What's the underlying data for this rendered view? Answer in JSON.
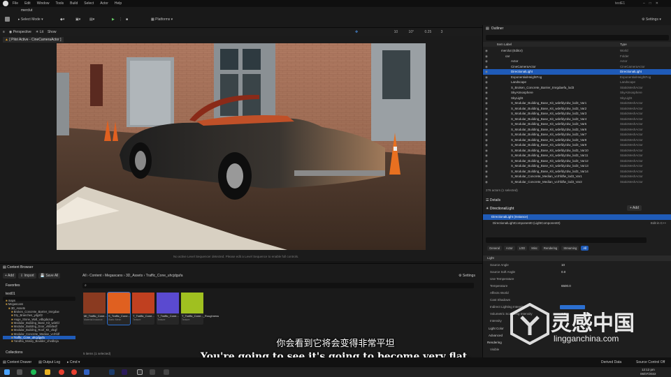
{
  "menubar": {
    "items": [
      "File",
      "Edit",
      "Window",
      "Tools",
      "Build",
      "Select",
      "Actor",
      "Help"
    ],
    "project": "testE1",
    "level": "merclut"
  },
  "toolbar": {
    "select_mode": "Select Mode",
    "platforms": "Platforms",
    "settings": "Settings"
  },
  "viewport": {
    "perspective": "Perspective",
    "lit": "Lit",
    "show": "Show",
    "pilot": "[ Pilot Active - CineCameraActor ]",
    "stats": [
      "10",
      "10°",
      "0.25",
      "3"
    ],
    "notice": "No active Level Sequencer detected. Please edit a Level Sequence to enable full controls."
  },
  "outliner": {
    "tab": "Outliner",
    "col_label": "Item Label",
    "col_type": "Type",
    "footer": "276 actors (1 selected)",
    "rows": [
      {
        "label": "merclut (Editor)",
        "type": "World"
      },
      {
        "label": "car",
        "type": "Folder"
      },
      {
        "label": "Actor",
        "type": "Actor"
      },
      {
        "label": "CineCameraActor",
        "type": "CineCameraActor"
      },
      {
        "label": "DirectionalLight",
        "type": "DirectionalLight",
        "selected": true
      },
      {
        "label": "ExponentialHeightFog",
        "type": "ExponentialHeightFog"
      },
      {
        "label": "Landscape",
        "type": "Landscape"
      },
      {
        "label": "S_Broken_Concrete_Barrier_tmrgdaefa_lod3",
        "type": "StaticMeshActor"
      },
      {
        "label": "SkyAtmosphere",
        "type": "SkyAtmosphere"
      },
      {
        "label": "SkyLight",
        "type": "SkyLight"
      },
      {
        "label": "S_Modular_Building_Base_Kit_wdefdyzdw_lod3_Var1",
        "type": "StaticMeshActor"
      },
      {
        "label": "S_Modular_Building_Base_Kit_wdefdyzdw_lod3_Var2",
        "type": "StaticMeshActor"
      },
      {
        "label": "S_Modular_Building_Base_Kit_wdefdyzdw_lod3_Var3",
        "type": "StaticMeshActor"
      },
      {
        "label": "S_Modular_Building_Base_Kit_wdefdyzdw_lod3_Var4",
        "type": "StaticMeshActor"
      },
      {
        "label": "S_Modular_Building_Base_Kit_wdefdyzdw_lod3_Var5",
        "type": "StaticMeshActor"
      },
      {
        "label": "S_Modular_Building_Base_Kit_wdefdyzdw_lod3_Var6",
        "type": "StaticMeshActor"
      },
      {
        "label": "S_Modular_Building_Base_Kit_wdefdyzdw_lod3_Var7",
        "type": "StaticMeshActor"
      },
      {
        "label": "S_Modular_Building_Base_Kit_wdefdyzdw_lod3_Var8",
        "type": "StaticMeshActor"
      },
      {
        "label": "S_Modular_Building_Base_Kit_wdefdyzdw_lod3_Var9",
        "type": "StaticMeshActor"
      },
      {
        "label": "S_Modular_Building_Base_Kit_wdefdyzdw_lod3_Var10",
        "type": "StaticMeshActor"
      },
      {
        "label": "S_Modular_Building_Base_Kit_wdefdyzdw_lod3_Var11",
        "type": "StaticMeshActor"
      },
      {
        "label": "S_Modular_Building_Base_Kit_wdefdyzdw_lod3_Var12",
        "type": "StaticMeshActor"
      },
      {
        "label": "S_Modular_Building_Base_Kit_wdefdyzdw_lod3_Var13",
        "type": "StaticMeshActor"
      },
      {
        "label": "S_Modular_Building_Base_Kit_wdefdyzdw_lod3_Var14",
        "type": "StaticMeshActor"
      },
      {
        "label": "S_Modular_Concrete_Median_vcrhfdfw_lod3_Var1",
        "type": "StaticMeshActor"
      },
      {
        "label": "S_Modular_Concrete_Median_vcrhfdfw_lod3_Var2",
        "type": "StaticMeshActor"
      }
    ]
  },
  "details": {
    "tab": "Details",
    "actor": "DirectionalLight",
    "add": "+ Add",
    "root": "DirectionalLight (Instance)",
    "component": "DirectionalLightComponent0 (LightComponent0)",
    "edit_in_cpp": "Edit in C++",
    "filters": [
      "General",
      "Actor",
      "LOD",
      "Misc",
      "Rendering",
      "Streaming",
      "All"
    ],
    "section_light": "Light",
    "props": [
      {
        "k": "Source Angle",
        "v": "10"
      },
      {
        "k": "Source Soft Angle",
        "v": "0.0"
      },
      {
        "k": "Use Temperature",
        "v": ""
      },
      {
        "k": "Temperature",
        "v": "6500.0"
      },
      {
        "k": "Affects World",
        "v": ""
      },
      {
        "k": "Cast Shadows",
        "v": ""
      },
      {
        "k": "Indirect Lighting Intensity",
        "v": "4.86"
      },
      {
        "k": "Volumetric Scattering Intensity",
        "v": "1.0"
      },
      {
        "k": "Intensity",
        "v": ""
      }
    ],
    "sections": [
      "Light Color",
      "Advanced",
      "Rendering",
      "Visible"
    ]
  },
  "content_browser": {
    "tab": "Content Browser",
    "add": "+ Add",
    "import": "Import",
    "save_all": "Save All",
    "favorites": "Favorites",
    "project": "test01",
    "collections": "Collections",
    "settings": "Settings",
    "breadcrumb": [
      "All",
      "Content",
      "Megascans",
      "3D_Assets",
      "Traffic_Cone_uhcjdgufa"
    ],
    "search_placeholder": "Search Traffic_Cone_uhcjdgufa",
    "tree": [
      "maps",
      "Megascans",
      "3D_Assets",
      "Broken_Concrete_Barrier_tmrgdae",
      "Dry_Branches_ydgsf2",
      "Huge_Stone_Wall_vdbgdazqa",
      "Modular_Building_Base_Kit_wdefd",
      "Modular_Building_Door_vhifafedf",
      "Modular_Building_Roof_Kit_vbqjf",
      "Modular_Concrete_Median_vcrhfdf",
      "Traffic_Cone_uhcjdgufa",
      "Yandha_Mossy_Boulder_vhvdbcja"
    ],
    "assets": [
      {
        "label": "MI_Traffic_Cone...",
        "sub": "Material Instance"
      },
      {
        "label": "S_Traffic_Cone...",
        "sub": "Static Mesh"
      },
      {
        "label": "T_Traffic_Cone...",
        "sub": "Texture"
      },
      {
        "label": "T_Traffic_Cone...",
        "sub": "Texture"
      },
      {
        "label": "T_Traffic_Cone..._Roughness",
        "sub": "Texture"
      }
    ],
    "footer": "5 items (1 selected)"
  },
  "statusbar": {
    "content_drawer": "Content Drawer",
    "output_log": "Output Log",
    "cmd": "Cmd",
    "derived_data": "Derived Data",
    "source_control": "Source Control Off"
  },
  "taskbar": {
    "time": "12:12 pm",
    "date": "06/07/2022"
  },
  "subtitles": {
    "zh": "你会看到它将会变得非常平坦",
    "en": "You're going to see it's going to become very flat."
  },
  "watermark": {
    "brand_cn": "灵感中国",
    "brand_en": "lingganchina.com"
  },
  "colors": {
    "select_blue": "#1f5bb8",
    "accent_orange": "#d98a20"
  }
}
